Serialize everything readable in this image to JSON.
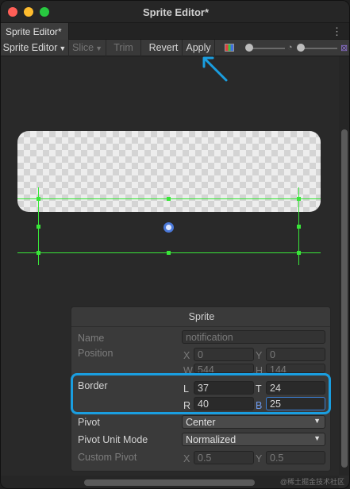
{
  "window": {
    "title": "Sprite Editor*"
  },
  "tab": {
    "label": "Sprite Editor*",
    "menu_glyph": "⋮"
  },
  "toolbar": {
    "mode_label": "Sprite Editor",
    "slice_label": "Slice",
    "trim_label": "Trim",
    "revert_label": "Revert",
    "apply_label": "Apply",
    "caret": "▼"
  },
  "panel": {
    "title": "Sprite",
    "name": {
      "label": "Name",
      "value": "notification"
    },
    "position": {
      "label": "Position",
      "x_label": "X",
      "x": "0",
      "y_label": "Y",
      "y": "0",
      "w_label": "W",
      "w": "544",
      "h_label": "H",
      "h": "144"
    },
    "border": {
      "label": "Border",
      "l_label": "L",
      "l": "37",
      "t_label": "T",
      "t": "24",
      "r_label": "R",
      "r": "40",
      "b_label": "B",
      "b": "25"
    },
    "pivot": {
      "label": "Pivot",
      "value": "Center"
    },
    "pivot_unit_mode": {
      "label": "Pivot Unit Mode",
      "value": "Normalized"
    },
    "custom_pivot": {
      "label": "Custom Pivot",
      "x_label": "X",
      "x": "0.5",
      "y_label": "Y",
      "y": "0.5"
    }
  },
  "colors": {
    "accent_highlight": "#1a9ee0",
    "grid_guides": "#39e639",
    "pivot": "#4a78d8"
  },
  "watermark": "@稀土掘金技术社区"
}
